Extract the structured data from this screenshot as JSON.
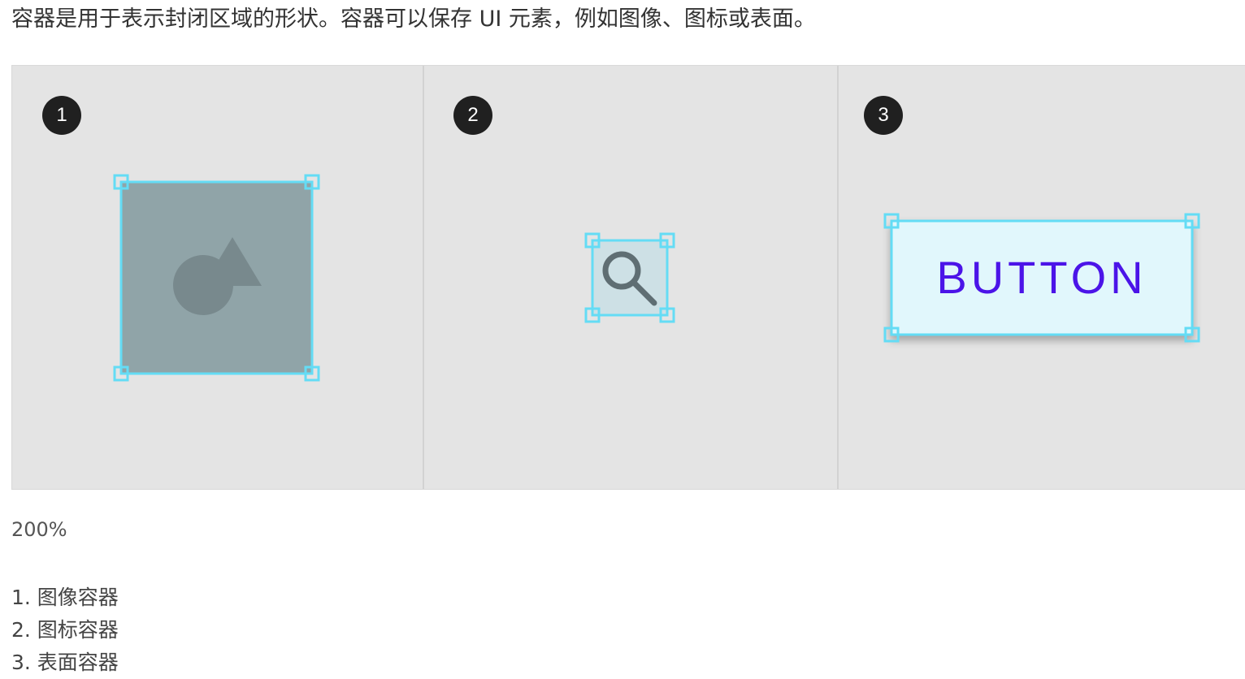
{
  "intro_text": "容器是用于表示封闭区域的形状。容器可以保存 UI 元素，例如图像、图标或表面。",
  "figure": {
    "panels": [
      {
        "badge": "1",
        "content": "image-placeholder"
      },
      {
        "badge": "2",
        "content": "search-icon"
      },
      {
        "badge": "3",
        "content": "button-surface",
        "button_label": "BUTTON"
      }
    ],
    "colors": {
      "background": "#e4e4e4",
      "badge": "#202020",
      "selection": "#64dcf5",
      "image_fill": "#90a4a8",
      "image_glyph": "#78898d",
      "icon_fill": "#cde0e5",
      "icon_glyph": "#5f6e73",
      "surface_fill": "#e1f7fc",
      "button_text": "#4b14e8"
    }
  },
  "scale_label": "200%",
  "legend": [
    "1. 图像容器",
    "2. 图标容器",
    "3. 表面容器"
  ]
}
